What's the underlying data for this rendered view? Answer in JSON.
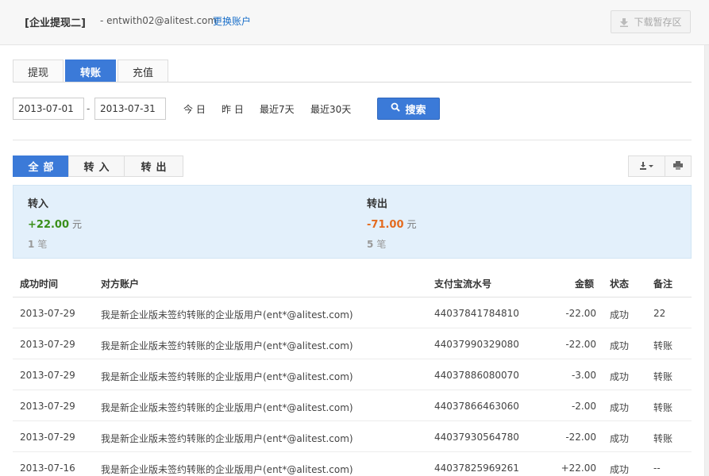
{
  "header": {
    "account_title": "[企业提现二]",
    "account_email": "- entwith02@alitest.com",
    "switch_account": "更换账户",
    "download_queue": "下载暂存区"
  },
  "tabs": [
    {
      "label": "提现",
      "active": false
    },
    {
      "label": "转账",
      "active": true
    },
    {
      "label": "充值",
      "active": false
    }
  ],
  "search": {
    "start_date": "2013-07-01",
    "date_separator": "-",
    "end_date": "2013-07-31",
    "quick": [
      "今 日",
      "昨 日",
      "最近7天",
      "最近30天"
    ],
    "button_label": "搜索"
  },
  "filters": [
    {
      "label": "全部",
      "active": true
    },
    {
      "label": "转入",
      "active": false
    },
    {
      "label": "转出",
      "active": false
    }
  ],
  "summary": {
    "in": {
      "label": "转入",
      "amount": "+22.00",
      "unit": "元",
      "count": "1",
      "count_unit": "笔"
    },
    "out": {
      "label": "转出",
      "amount": "-71.00",
      "unit": "元",
      "count": "5",
      "count_unit": "笔"
    }
  },
  "table": {
    "headers": {
      "time": "成功时间",
      "counterparty": "对方账户",
      "serial": "支付宝流水号",
      "amount": "金额",
      "status": "状态",
      "note": "备注"
    },
    "rows": [
      {
        "time": "2013-07-29",
        "counterparty": "我是新企业版未签约转账的企业版用户(ent*@alitest.com)",
        "serial": "44037841784810",
        "amount": "-22.00",
        "status": "成功",
        "note": "22"
      },
      {
        "time": "2013-07-29",
        "counterparty": "我是新企业版未签约转账的企业版用户(ent*@alitest.com)",
        "serial": "44037990329080",
        "amount": "-22.00",
        "status": "成功",
        "note": "转账"
      },
      {
        "time": "2013-07-29",
        "counterparty": "我是新企业版未签约转账的企业版用户(ent*@alitest.com)",
        "serial": "44037886080070",
        "amount": "-3.00",
        "status": "成功",
        "note": "转账"
      },
      {
        "time": "2013-07-29",
        "counterparty": "我是新企业版未签约转账的企业版用户(ent*@alitest.com)",
        "serial": "44037866463060",
        "amount": "-2.00",
        "status": "成功",
        "note": "转账"
      },
      {
        "time": "2013-07-29",
        "counterparty": "我是新企业版未签约转账的企业版用户(ent*@alitest.com)",
        "serial": "44037930564780",
        "amount": "-22.00",
        "status": "成功",
        "note": "转账"
      },
      {
        "time": "2013-07-16",
        "counterparty": "我是新企业版未签约转账的企业版用户(ent*@alitest.com)",
        "serial": "44037825969261",
        "amount": "+22.00",
        "status": "成功",
        "note": "--"
      }
    ]
  },
  "colors": {
    "accent": "#3b7ad8",
    "income": "#3a8f1a",
    "expense": "#e46b1e",
    "summary_bg": "#e3f0fb"
  },
  "icons": {
    "download_queue": "download-arrow-icon",
    "search": "search-icon",
    "export": "export-download-icon",
    "print": "print-icon"
  }
}
